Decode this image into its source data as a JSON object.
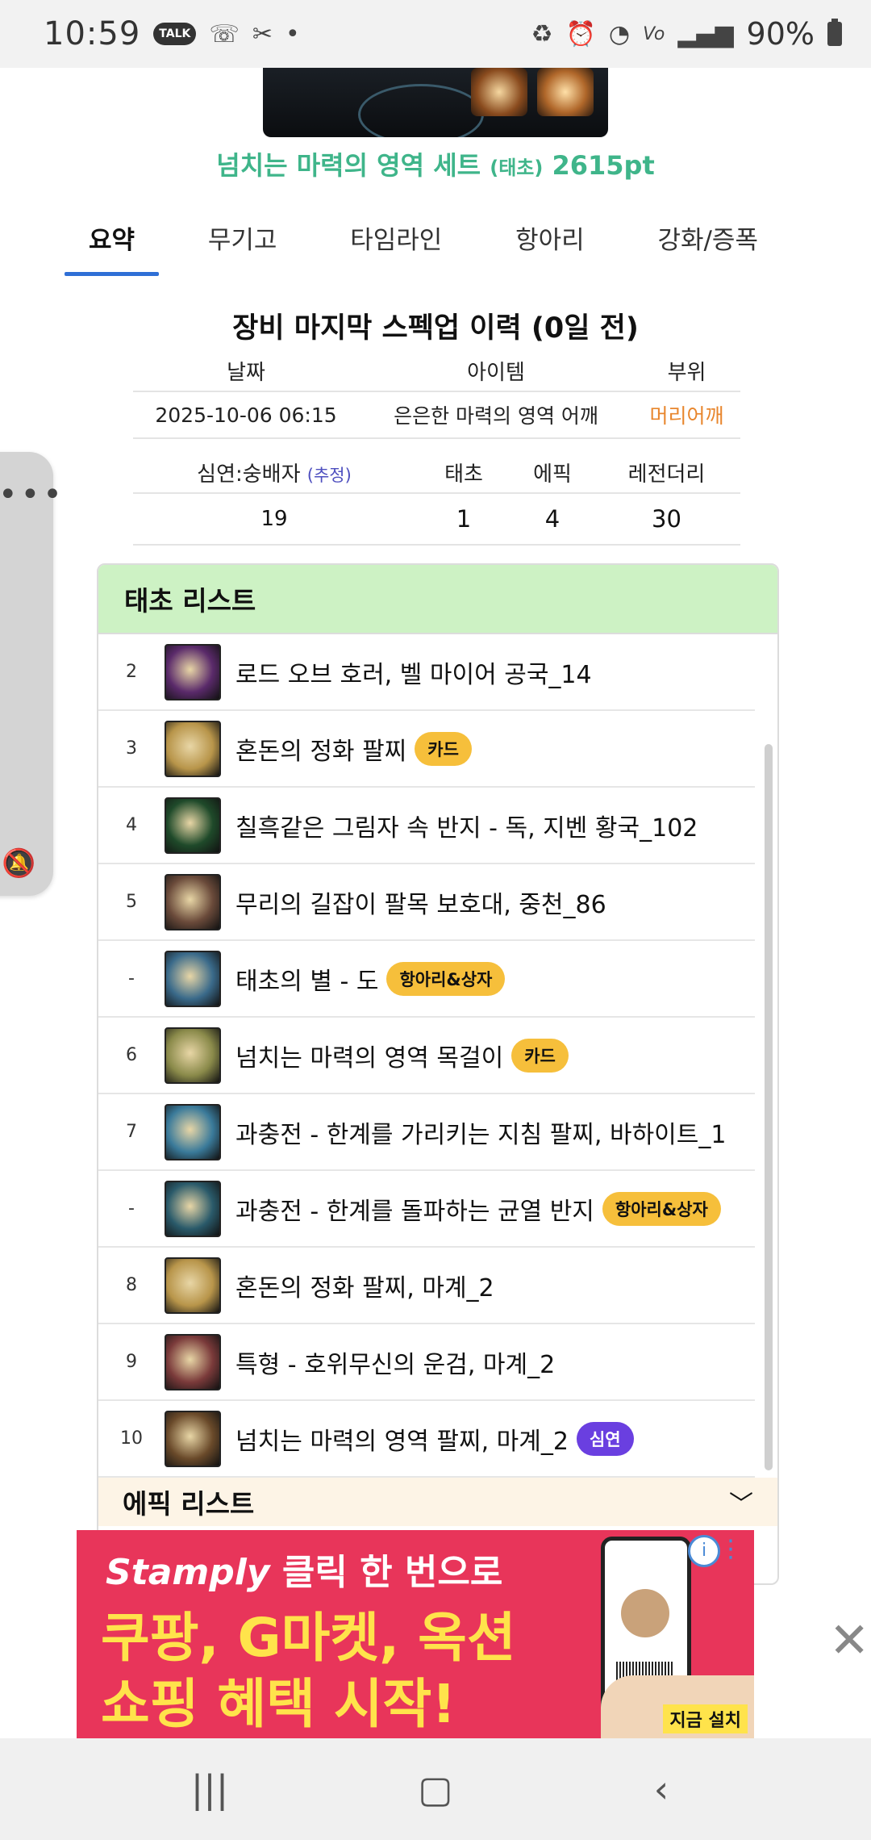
{
  "status_bar": {
    "time": "10:59",
    "battery": "90%",
    "left_icons": [
      "talk-icon",
      "call-icon",
      "tools-icon",
      "dot-icon"
    ],
    "right_icons": [
      "battery-saver-icon",
      "alarm-icon",
      "wifi-icon",
      "volte-icon",
      "signal-icon",
      "battery-icon"
    ]
  },
  "set": {
    "name": "넘치는 마력의 영역 세트",
    "tier": "(태초)",
    "points": "2615pt"
  },
  "tabs": [
    {
      "label": "요약",
      "active": true
    },
    {
      "label": "무기고",
      "active": false
    },
    {
      "label": "타임라인",
      "active": false
    },
    {
      "label": "항아리",
      "active": false
    },
    {
      "label": "강화/증폭",
      "active": false
    }
  ],
  "history": {
    "title": "장비 마지막 스펙업 이력 (0일 전)",
    "headers": [
      "날짜",
      "아이템",
      "부위"
    ],
    "row": {
      "date": "2025-10-06 06:15",
      "item": "은은한 마력의 영역 어깨",
      "slot": "머리어깨"
    }
  },
  "counts": {
    "headers": {
      "abyss": "심연:숭배자",
      "estimate": "(추정)",
      "primeval": "태초",
      "epic": "에픽",
      "legendary": "레전더리"
    },
    "values": {
      "abyss": "19",
      "primeval": "1",
      "epic": "4",
      "legendary": "30"
    }
  },
  "primeval_list": {
    "title": "태초 리스트",
    "items": [
      {
        "num": "2",
        "name": "로드 오브 호러, 벨 마이어 공국_14",
        "badge": "",
        "icon": "staff-icon",
        "color": "#5a2a6a"
      },
      {
        "num": "3",
        "name": "혼돈의 정화 팔찌",
        "badge": "카드",
        "icon": "bracelet-icon",
        "color": "#b8954a"
      },
      {
        "num": "4",
        "name": "칠흑같은 그림자 속 반지 - 독, 지벤 황국_102",
        "badge": "",
        "icon": "ring-icon",
        "color": "#1f4a2a"
      },
      {
        "num": "5",
        "name": "무리의 길잡이 팔목 보호대, 중천_86",
        "badge": "",
        "icon": "bracer-icon",
        "color": "#6a4a3a"
      },
      {
        "num": "-",
        "name": "태초의 별 - 도",
        "badge": "항아리&상자",
        "icon": "blade-icon",
        "color": "#3a6a8a"
      },
      {
        "num": "6",
        "name": "넘치는 마력의 영역 목걸이",
        "badge": "카드",
        "icon": "necklace-icon",
        "color": "#8a8a4a"
      },
      {
        "num": "7",
        "name": "과충전 - 한계를 가리키는 지침 팔찌, 바하이트_1",
        "badge": "",
        "icon": "bracelet-icon",
        "color": "#3a7a9a"
      },
      {
        "num": "-",
        "name": "과충전 - 한계를 돌파하는 균열 반지",
        "badge": "항아리&상자",
        "icon": "ring-icon",
        "color": "#2a5a6a"
      },
      {
        "num": "8",
        "name": "혼돈의 정화 팔찌, 마계_2",
        "badge": "",
        "icon": "bracelet-icon",
        "color": "#b8954a"
      },
      {
        "num": "9",
        "name": "특형 - 호위무신의 운검, 마계_2",
        "badge": "",
        "icon": "sword-icon",
        "color": "#7a3a3a"
      },
      {
        "num": "10",
        "name": "넘치는 마력의 영역 팔찌, 마계_2",
        "badge": "심연",
        "icon": "bracelet-icon",
        "color": "#6a4a2a"
      }
    ]
  },
  "epic_list": {
    "title": "에픽 리스트"
  },
  "ad": {
    "brand": "Stamply",
    "line1": "클릭 한 번으로",
    "line2": "쿠팡, G마켓, 옥션",
    "line3": "쇼핑 혜택 시작!",
    "install": "지금 설치"
  }
}
